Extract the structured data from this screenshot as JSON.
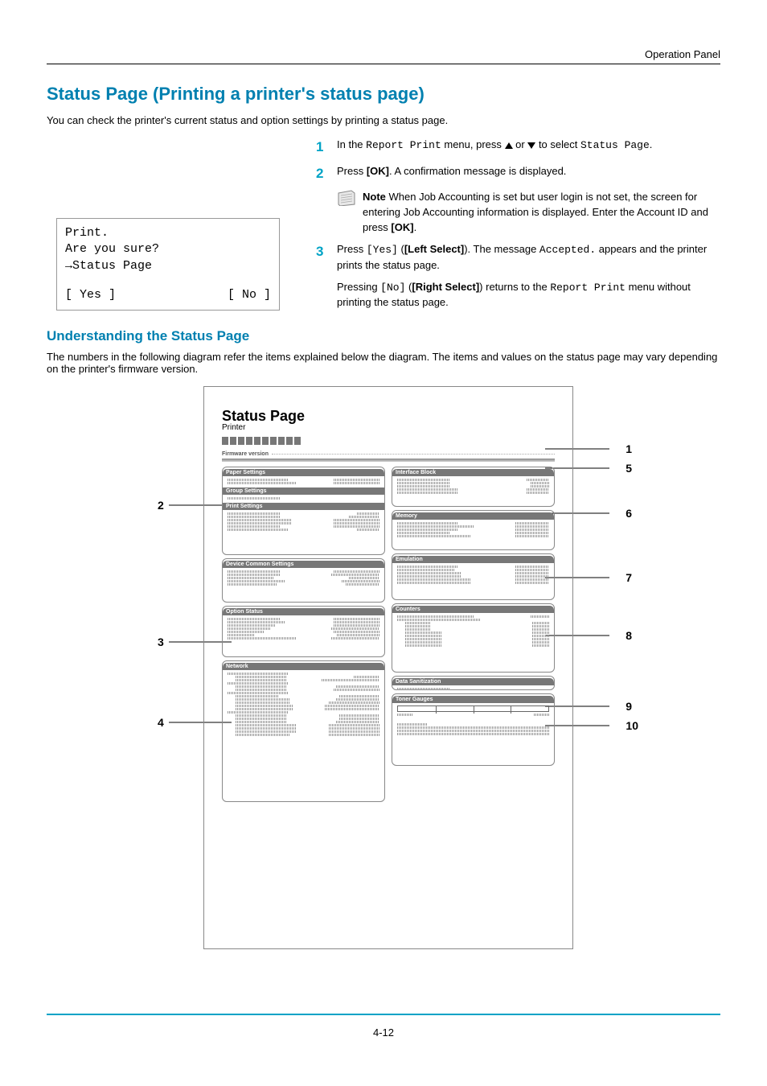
{
  "header": {
    "section": "Operation Panel"
  },
  "title": "Status Page (Printing a printer's status page)",
  "intro": "You can check the printer's current status and option settings by printing a status page.",
  "steps": {
    "s1_pre": "In the ",
    "s1_menu": "Report Print",
    "s1_mid": " menu, press ",
    "s1_post": " to select ",
    "s1_item": "Status Page",
    "s1_end": ".",
    "s2_pre": "Press ",
    "s2_key": "[OK]",
    "s2_post": ". A confirmation message is displayed.",
    "note_label": "Note",
    "note_body": "  When Job Accounting is set but user login is not set, the screen for entering Job Accounting information is displayed. Enter the Account ID and press ",
    "note_key": "[OK]",
    "note_end": ".",
    "s3_pre": "Press ",
    "s3_code": "[Yes]",
    "s3_mid1": " (",
    "s3_bold1": "[Left Select]",
    "s3_mid2": "). The message ",
    "s3_code2": "Accepted.",
    "s3_post": " appears and the printer prints the status page.",
    "s3b_pre": "Pressing ",
    "s3b_code": "[No]",
    "s3b_mid1": " (",
    "s3b_bold1": "[Right Select]",
    "s3b_mid2": ") returns to the ",
    "s3b_code2": "Report Print",
    "s3b_post": " menu without printing the status page."
  },
  "lcd": {
    "l1": "Print.",
    "l2": "Are you sure?",
    "l3": "→Status Page",
    "yes": "[  Yes  ]",
    "no": "[  No   ]"
  },
  "sub_heading": "Understanding the Status Page",
  "sub_body": "The numbers in the following diagram refer the items explained below the diagram. The items and values on the status page may vary depending on the printer's firmware version.",
  "status_page": {
    "title": "Status Page",
    "printer": "Printer",
    "fw": "Firmware version",
    "blocks_left": [
      "Paper Settings",
      "Group Settings",
      "Print Settings",
      "Device Common Settings",
      "Option Status",
      "Network"
    ],
    "blocks_right": [
      "Interface Block",
      "Memory",
      "Emulation",
      "Counters",
      "Data Sanitization",
      "Toner Gauges"
    ]
  },
  "labels": {
    "n1": "1",
    "n2": "2",
    "n3": "3",
    "n4": "4",
    "n5": "5",
    "n6": "6",
    "n7": "7",
    "n8": "8",
    "n9": "9",
    "n10": "10"
  },
  "pagenum": "4-12"
}
